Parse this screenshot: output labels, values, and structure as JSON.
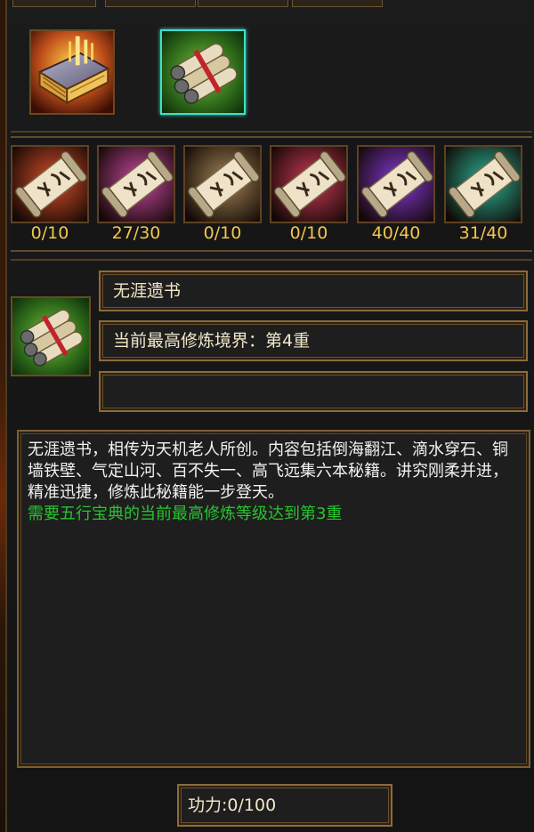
{
  "top_items": [
    {
      "name": "golden-tome-icon",
      "selected": false
    },
    {
      "name": "bundled-scrolls-icon",
      "selected": true
    }
  ],
  "scrolls": [
    {
      "name": "red-scroll-icon",
      "count": "0/10",
      "color": "#e0502a"
    },
    {
      "name": "pink-scroll-icon",
      "count": "27/30",
      "color": "#d04aa8"
    },
    {
      "name": "bronze-scroll-icon",
      "count": "0/10",
      "color": "#a88a5a"
    },
    {
      "name": "crimson-scroll-icon",
      "count": "0/10",
      "color": "#d23a5a"
    },
    {
      "name": "purple-scroll-icon",
      "count": "40/40",
      "color": "#8a3ae0"
    },
    {
      "name": "teal-scroll-icon",
      "count": "31/40",
      "color": "#2ab89a"
    }
  ],
  "detail": {
    "title": "无涯遗书",
    "realm": "当前最高修炼境界：第4重",
    "extra": ""
  },
  "description": {
    "text": "无涯遗书，相传为天机老人所创。内容包括倒海翻江、滴水穿石、铜墙铁壁、气定山河、百不失一、高飞远集六本秘籍。讲究刚柔并进，精准迅捷，修炼此秘籍能一步登天。",
    "requirement": "需要五行宝典的当前最高修炼等级达到第3重",
    "requirement_color": "#27c52f"
  },
  "power": {
    "text": "功力:0/100"
  },
  "colors": {
    "count_text": "#f3c64d",
    "border_gold": "#8c6b3a",
    "selected_border": "#3fe0c9"
  }
}
